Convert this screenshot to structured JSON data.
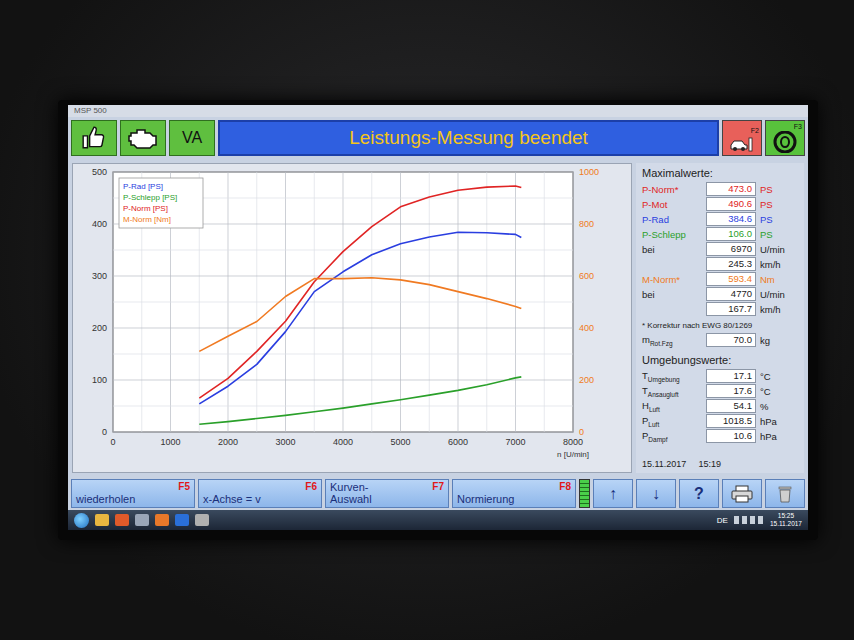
{
  "window": {
    "title": "MSP 500"
  },
  "header": {
    "title": "Leistungs-Messung beendet",
    "left_buttons": [
      {
        "kind": "thumbs-up",
        "label": ""
      },
      {
        "kind": "engine",
        "label": ""
      },
      {
        "kind": "text",
        "label": "VA"
      }
    ],
    "right_buttons": [
      {
        "kind": "car-lift",
        "key": "F2",
        "color": "#e8605a"
      },
      {
        "kind": "tire",
        "key": "F3",
        "color": "#58c23c"
      }
    ]
  },
  "chart": {
    "legend": [
      {
        "label": "P-Rad [PS]",
        "color": "#2a3ee0"
      },
      {
        "label": "P-Schlepp [PS]",
        "color": "#2aa02a"
      },
      {
        "label": "P-Norm [PS]",
        "color": "#e02424"
      },
      {
        "label": "M-Norm [Nm]",
        "color": "#f07a22"
      }
    ],
    "y_ticks_left": [
      "0",
      "100",
      "200",
      "300",
      "400",
      "500"
    ],
    "y_ticks_right": [
      "0",
      "200",
      "400",
      "600",
      "800",
      "1000"
    ],
    "x_ticks": [
      "0",
      "1000",
      "2000",
      "3000",
      "4000",
      "5000",
      "6000",
      "7000",
      "8000"
    ],
    "x_label": "n [U/min]",
    "x_values": [
      1500,
      2000,
      2500,
      3000,
      3500,
      4000,
      4500,
      5000,
      5500,
      6000,
      6500,
      7000,
      7100
    ],
    "series": [
      {
        "name": "P-Rad",
        "axis": "left",
        "color": "#2a3ee0",
        "values": [
          54,
          88,
          130,
          193,
          270,
          308,
          341,
          362,
          375,
          384,
          383,
          380,
          374
        ]
      },
      {
        "name": "P-Schlepp",
        "axis": "left",
        "color": "#2aa02a",
        "values": [
          15,
          20,
          26,
          32,
          39,
          46,
          54,
          62,
          71,
          80,
          91,
          104,
          106
        ]
      },
      {
        "name": "P-Norm",
        "axis": "left",
        "color": "#e02424",
        "values": [
          65,
          103,
          155,
          213,
          289,
          347,
          395,
          433,
          452,
          465,
          471,
          473,
          470
        ]
      },
      {
        "name": "M-Norm",
        "axis": "right",
        "color": "#f07a22",
        "values": [
          310,
          368,
          425,
          521,
          590,
          590,
          593,
          585,
          567,
          540,
          513,
          483,
          475
        ]
      }
    ]
  },
  "max_values": {
    "title": "Maximalwerte:",
    "rows": [
      {
        "label": "P-Norm*",
        "value": "473.0",
        "unit": "PS",
        "color": "#e02424"
      },
      {
        "label": "P-Mot",
        "value": "490.6",
        "unit": "PS",
        "color": "#e02424"
      },
      {
        "label": "P-Rad",
        "value": "384.6",
        "unit": "PS",
        "color": "#2a3ee0"
      },
      {
        "label": "P-Schlepp",
        "value": "106.0",
        "unit": "PS",
        "color": "#2aa02a"
      },
      {
        "label": "bei",
        "value": "6970",
        "unit": "U/min",
        "color": "#222222"
      },
      {
        "label": "",
        "value": "245.3",
        "unit": "km/h",
        "color": "#222222"
      },
      {
        "label": "M-Norm*",
        "value": "593.4",
        "unit": "Nm",
        "color": "#f07a22"
      },
      {
        "label": "bei",
        "value": "4770",
        "unit": "U/min",
        "color": "#222222"
      },
      {
        "label": "",
        "value": "167.7",
        "unit": "km/h",
        "color": "#222222"
      }
    ],
    "note": "* Korrektur nach EWG 80/1269",
    "mass": {
      "label": "m",
      "sub": "Rot.Fzg",
      "value": "70.0",
      "unit": "kg"
    }
  },
  "ambient": {
    "title": "Umgebungswerte:",
    "rows": [
      {
        "label": "T",
        "sub": "Umgebung",
        "value": "17.1",
        "unit": "°C"
      },
      {
        "label": "T",
        "sub": "Ansaugluft",
        "value": "17.6",
        "unit": "°C"
      },
      {
        "label": "H",
        "sub": "Luft",
        "value": "54.1",
        "unit": "%"
      },
      {
        "label": "P",
        "sub": "Luft",
        "value": "1018.5",
        "unit": "hPa"
      },
      {
        "label": "P",
        "sub": "Dampf",
        "value": "10.6",
        "unit": "hPa"
      }
    ]
  },
  "timestamp": {
    "date": "15.11.2017",
    "time": "15:19"
  },
  "function_keys": [
    {
      "lines": [
        "wiederholen"
      ],
      "key": "F5"
    },
    {
      "lines": [
        "x-Achse = v"
      ],
      "key": "F6"
    },
    {
      "lines": [
        "Kurven-",
        "Auswahl"
      ],
      "key": "F7"
    },
    {
      "lines": [
        "Normierung"
      ],
      "key": "F8"
    }
  ],
  "status_led": {
    "on": true
  },
  "nav_buttons": [
    {
      "kind": "text",
      "label": "↑"
    },
    {
      "kind": "text",
      "label": "↓"
    },
    {
      "kind": "text",
      "label": "?"
    },
    {
      "kind": "print",
      "label": ""
    },
    {
      "kind": "delete",
      "label": ""
    }
  ],
  "taskbar": {
    "apps": [
      "start",
      "explorer",
      "media",
      "msp",
      "firefox",
      "teamviewer",
      "tool"
    ],
    "lang": "DE",
    "time": "15:25",
    "date": "15.11.2017"
  }
}
